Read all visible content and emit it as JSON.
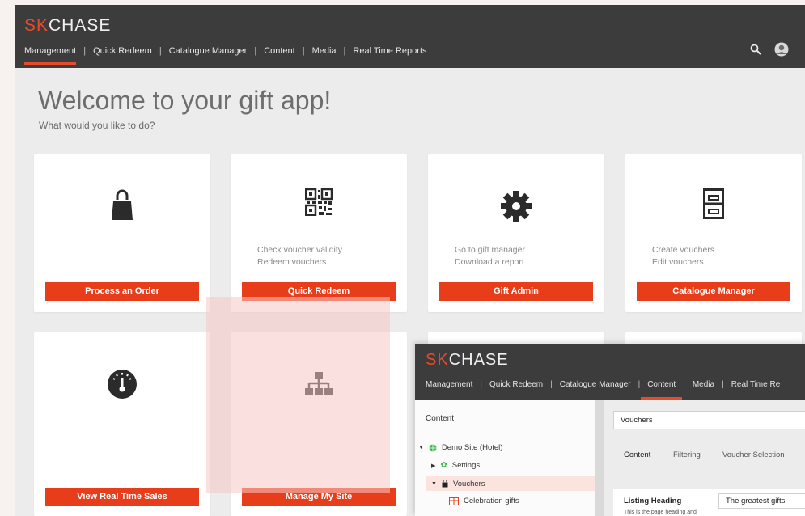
{
  "app": {
    "logo_prefix": "SK",
    "logo_suffix": "CHASE",
    "nav": [
      {
        "label": "Management",
        "active": true
      },
      {
        "label": "Quick Redeem",
        "active": false
      },
      {
        "label": "Catalogue Manager",
        "active": false
      },
      {
        "label": "Content",
        "active": false
      },
      {
        "label": "Media",
        "active": false
      },
      {
        "label": "Real Time Reports",
        "active": false
      }
    ],
    "nav_separator": "|"
  },
  "welcome": {
    "title": "Welcome to your gift app!",
    "subtitle": "What would you like to do?"
  },
  "cards": [
    {
      "icon": "shopping-bag-icon",
      "desc_line1": "",
      "desc_line2": "",
      "button": "Process an Order"
    },
    {
      "icon": "qr-code-icon",
      "desc_line1": "Check voucher validity",
      "desc_line2": "Redeem vouchers",
      "button": "Quick Redeem"
    },
    {
      "icon": "gear-icon",
      "desc_line1": "Go to gift manager",
      "desc_line2": "Download a report",
      "button": "Gift Admin"
    },
    {
      "icon": "filing-cabinet-icon",
      "desc_line1": "Create vouchers",
      "desc_line2": "Edit vouchers",
      "button": "Catalogue Manager"
    },
    {
      "icon": "speedometer-icon",
      "desc_line1": "",
      "desc_line2": "",
      "button": "View Real Time Sales"
    },
    {
      "icon": "sitemap-icon",
      "desc_line1": "",
      "desc_line2": "",
      "button": "Manage My Site"
    }
  ],
  "inset": {
    "logo_prefix": "SK",
    "logo_suffix": "CHASE",
    "nav": [
      {
        "label": "Management",
        "active": false
      },
      {
        "label": "Quick Redeem",
        "active": false
      },
      {
        "label": "Catalogue Manager",
        "active": false
      },
      {
        "label": "Content",
        "active": true
      },
      {
        "label": "Media",
        "active": false
      },
      {
        "label": "Real Time Re",
        "active": false
      }
    ],
    "left_panel_title": "Content",
    "tree": [
      {
        "label": "Demo Site (Hotel)",
        "icon": "globe-icon"
      },
      {
        "label": "Settings",
        "icon": "gear-icon"
      },
      {
        "label": "Vouchers",
        "icon": "bag-icon"
      },
      {
        "label": "Celebration gifts",
        "icon": "gift-icon"
      }
    ],
    "name_value": "Vouchers",
    "tabs": [
      "Content",
      "Filtering",
      "Voucher Selection"
    ],
    "listing_heading_label": "Listing Heading",
    "listing_heading_hint": "This is the page heading and",
    "listing_heading_value": "The greatest gifts"
  },
  "colors": {
    "accent": "#e83d1a",
    "topbar": "#3c3c3c",
    "overlay": "#f6c8c4"
  }
}
